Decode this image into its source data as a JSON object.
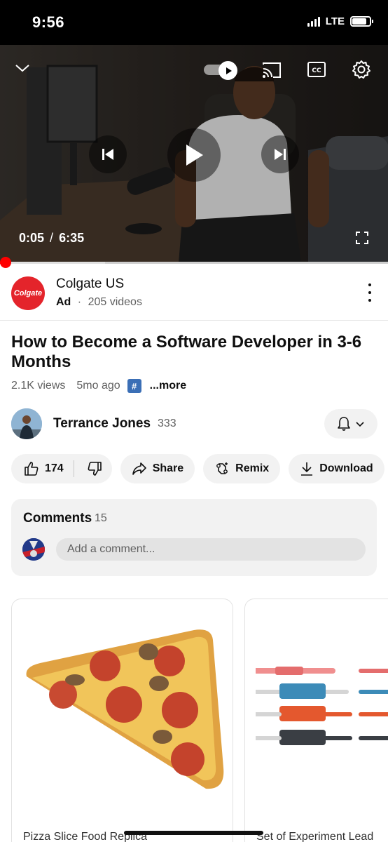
{
  "status": {
    "time": "9:56",
    "network": "LTE"
  },
  "player": {
    "current_time": "0:05",
    "time_separator": "/",
    "duration": "6:35",
    "progress": 0.013,
    "buffered": 0.27
  },
  "ad": {
    "logo_text": "Colgate",
    "name": "Colgate US",
    "label": "Ad",
    "dot": "·",
    "videos": "205 videos"
  },
  "video": {
    "title": "How to Become a Software Developer in 3-6 Months",
    "views": "2.1K views",
    "age": "5mo ago",
    "hashtag": "#",
    "more": "...more"
  },
  "channel": {
    "name": "Terrance Jones",
    "subscribers": "333"
  },
  "actions": {
    "likes": "174",
    "share": "Share",
    "remix": "Remix",
    "download": "Download"
  },
  "comments": {
    "title": "Comments",
    "count": "15",
    "placeholder": "Add a comment..."
  },
  "shopping": [
    {
      "title": "Pizza Slice Food Replica"
    },
    {
      "title": "Set of Experiment Lead"
    }
  ],
  "icons": {
    "chevron": "chevron-down-icon",
    "autoplay": "autoplay-toggle-icon",
    "cast": "cast-icon",
    "captions": "closed-captions-icon",
    "settings": "gear-icon",
    "previous": "skip-previous-icon",
    "play": "play-icon",
    "next": "skip-next-icon",
    "fullscreen": "fullscreen-icon",
    "kebab": "more-vertical-icon",
    "bell": "bell-icon",
    "like": "thumbs-up-icon",
    "dislike": "thumbs-down-icon",
    "share": "share-arrow-icon",
    "remix": "remix-icon",
    "download": "download-icon"
  },
  "colors": {
    "progress": "#ff0000",
    "colgate_red": "#e4242b",
    "pill_bg": "#f2f2f2"
  }
}
